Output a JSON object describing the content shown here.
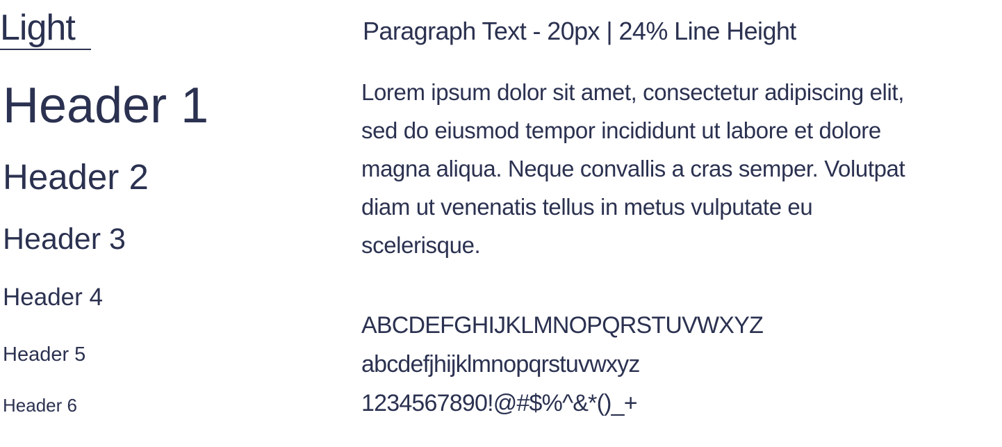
{
  "typography": {
    "weight_label": "Light",
    "headers": [
      "Header 1",
      "Header 2",
      "Header 3",
      "Header 4",
      "Header 5",
      "Header 6"
    ]
  },
  "paragraph": {
    "heading": "Paragraph Text - 20px | 24% Line Height",
    "body_lines": [
      "Lorem ipsum dolor sit amet, consectetur adipiscing elit,",
      "sed do eiusmod tempor incididunt ut labore et dolore",
      "magna aliqua. Neque convallis a cras semper. Volutpat",
      "diam ut venenatis tellus in metus vulputate eu",
      "scelerisque."
    ]
  },
  "character_set": {
    "uppercase": "ABCDEFGHIJKLMNOPQRSTUVWXYZ",
    "lowercase": "abcdefjhijklmnopqrstuvwxyz",
    "numbers_symbols": "1234567890!@#$%^&*()_+"
  },
  "colors": {
    "text": "#2b3150",
    "background": "#ffffff"
  }
}
